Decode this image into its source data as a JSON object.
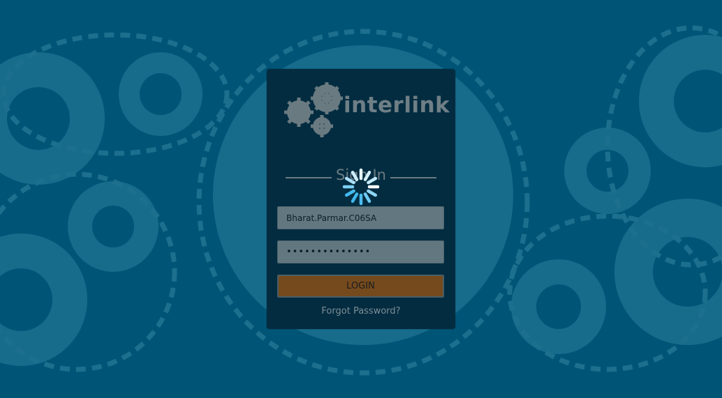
{
  "brand": {
    "logo_text": "interlink",
    "colors": {
      "background": "#005577",
      "card": "#032c40",
      "login_button": "#754a1d",
      "spinner_light": "#bfe9ff",
      "spinner_mid": "#3fb7ee"
    }
  },
  "login": {
    "heading": "Sign In",
    "username_value": "Bharat.Parmar.C06SA",
    "password_value": "••••••••••••••",
    "login_label": "LOGIN",
    "forgot_label": "Forgot Password?",
    "spinner_icon": "loading-spinner-icon"
  }
}
